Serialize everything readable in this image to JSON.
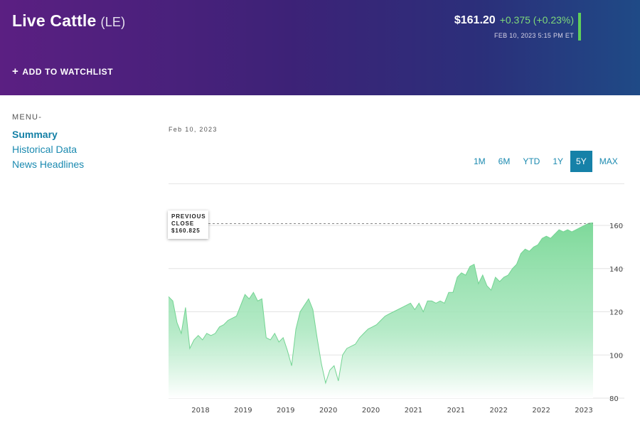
{
  "header": {
    "title": "Live Cattle",
    "ticker": "(LE)",
    "price": "$161.20",
    "change": "+0.375 (+0.23%)",
    "timestamp": "FEB 10, 2023 5:15 PM ET",
    "watchlist_label": "ADD TO WATCHLIST"
  },
  "menu": {
    "title": "MENU-",
    "items": [
      {
        "label": "Summary",
        "active": true
      },
      {
        "label": "Historical Data",
        "active": false
      },
      {
        "label": "News Headlines",
        "active": false
      }
    ]
  },
  "chart": {
    "date": "Feb 10, 2023",
    "ranges": [
      {
        "label": "1M",
        "active": false
      },
      {
        "label": "6M",
        "active": false
      },
      {
        "label": "YTD",
        "active": false
      },
      {
        "label": "1Y",
        "active": false
      },
      {
        "label": "5Y",
        "active": true
      },
      {
        "label": "MAX",
        "active": false
      }
    ],
    "callout": {
      "line1": "PREVIOUS",
      "line2": "CLOSE",
      "line3": "$160.825"
    }
  },
  "colors": {
    "accent": "#1681a8",
    "positive": "#7fd97a",
    "area_fill": "#7ed99a"
  },
  "chart_data": {
    "type": "area",
    "x_tick_labels": [
      "2018",
      "2019",
      "2019",
      "2020",
      "2020",
      "2021",
      "2021",
      "2022",
      "2022",
      "2023"
    ],
    "y_ticks": [
      80,
      100,
      120,
      140,
      160
    ],
    "ylim": [
      80,
      160
    ],
    "grid": true,
    "reference_line": {
      "label": "PREVIOUS CLOSE",
      "value": 160.825
    },
    "x": [
      0.0,
      0.01,
      0.02,
      0.03,
      0.04,
      0.05,
      0.06,
      0.07,
      0.08,
      0.09,
      0.1,
      0.11,
      0.12,
      0.13,
      0.14,
      0.15,
      0.16,
      0.17,
      0.18,
      0.19,
      0.2,
      0.21,
      0.22,
      0.23,
      0.24,
      0.25,
      0.26,
      0.27,
      0.28,
      0.29,
      0.3,
      0.31,
      0.32,
      0.33,
      0.34,
      0.35,
      0.36,
      0.37,
      0.38,
      0.39,
      0.4,
      0.41,
      0.42,
      0.43,
      0.44,
      0.45,
      0.46,
      0.47,
      0.48,
      0.49,
      0.5,
      0.51,
      0.52,
      0.53,
      0.54,
      0.55,
      0.56,
      0.57,
      0.58,
      0.59,
      0.6,
      0.61,
      0.62,
      0.63,
      0.64,
      0.65,
      0.66,
      0.67,
      0.68,
      0.69,
      0.7,
      0.71,
      0.72,
      0.73,
      0.74,
      0.75,
      0.76,
      0.77,
      0.78,
      0.79,
      0.8,
      0.81,
      0.82,
      0.83,
      0.84,
      0.85,
      0.86,
      0.87,
      0.88,
      0.89,
      0.9,
      0.91,
      0.92,
      0.93,
      0.94,
      0.95,
      0.96,
      0.97,
      0.98,
      0.99,
      1.0
    ],
    "values": [
      127,
      125,
      115,
      110,
      122,
      103,
      107,
      109,
      107,
      110,
      109,
      110,
      113,
      114,
      116,
      117,
      118,
      123,
      128,
      126,
      129,
      125,
      126,
      108,
      107,
      110,
      106,
      108,
      102,
      95,
      112,
      120,
      123,
      126,
      121,
      108,
      96,
      87,
      93,
      95,
      88,
      100,
      103,
      104,
      105,
      108,
      110,
      112,
      113,
      114,
      116,
      118,
      119,
      120,
      121,
      122,
      123,
      124,
      121,
      124,
      120,
      125,
      125,
      124,
      125,
      124,
      129,
      129,
      136,
      138,
      137,
      141,
      142,
      133,
      137,
      132,
      130,
      136,
      134,
      136,
      137,
      140,
      142,
      147,
      149,
      148,
      150,
      151,
      154,
      155,
      154,
      156,
      158,
      157,
      158,
      157,
      158,
      159,
      160,
      161,
      161.2
    ]
  }
}
